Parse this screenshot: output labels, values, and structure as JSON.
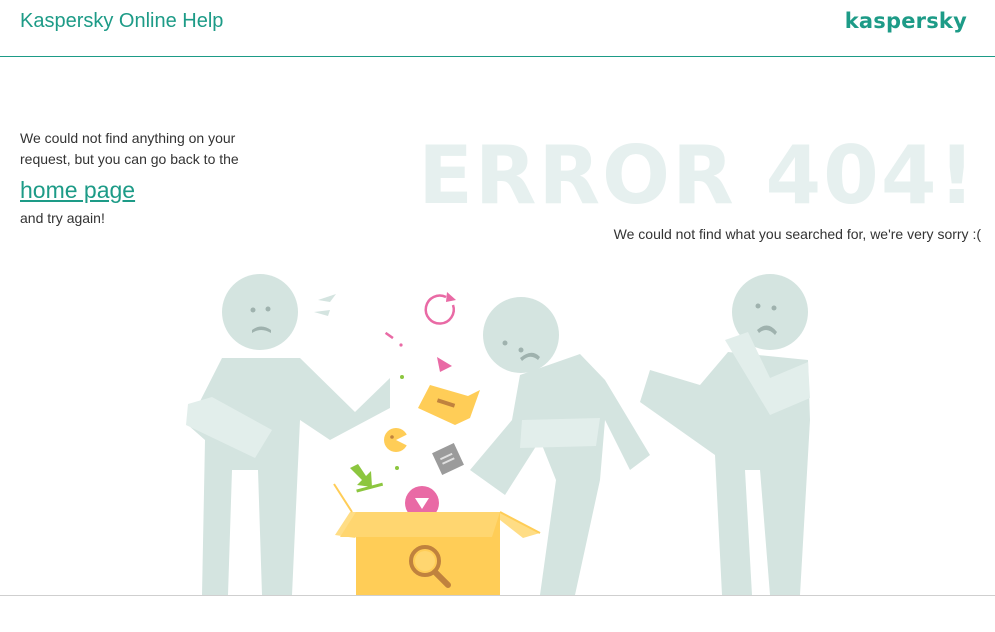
{
  "header": {
    "title": "Kaspersky Online Help",
    "logo": "kaspersky",
    "accent_color": "#1d9b87"
  },
  "message": {
    "line1": "We could not find anything on your request, but you can go back to the",
    "home_link": "home page",
    "line2": "and try again!"
  },
  "error": {
    "title": "ERROR 404!",
    "subtitle": "We could not find what you searched for, we're very sorry :("
  },
  "illustration": {
    "figure_color": "#d4e4e0",
    "box_color": "#ffcd57",
    "icons": [
      "refresh-icon",
      "folder-icon",
      "document-icon",
      "download-arrow-icon",
      "play-icon",
      "magnifier-icon"
    ]
  }
}
